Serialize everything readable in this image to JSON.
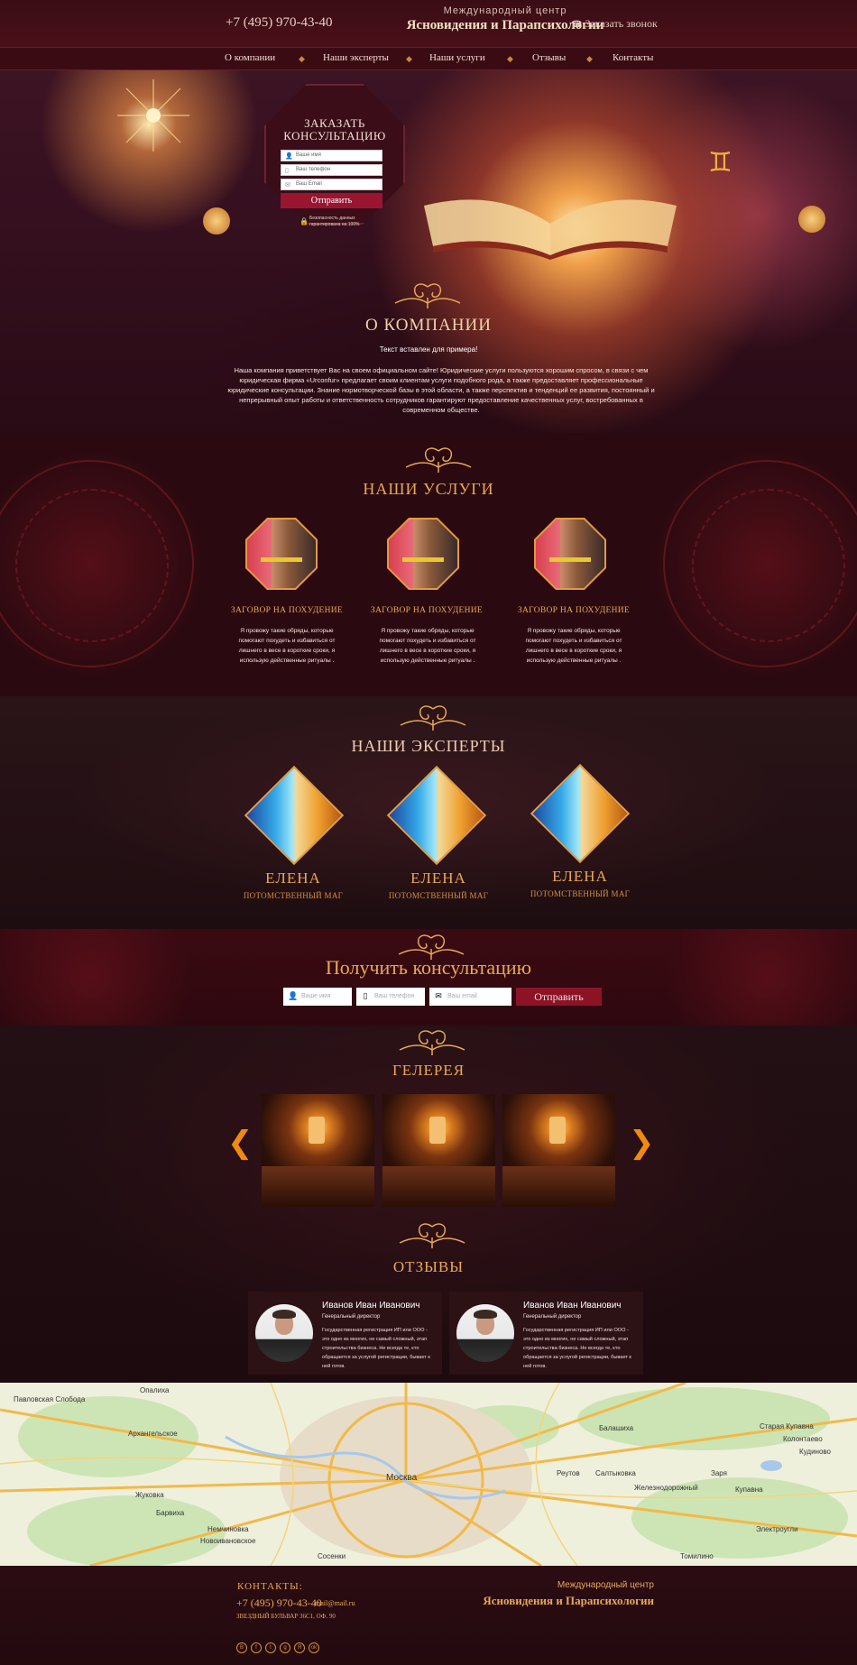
{
  "header": {
    "phone": "+7 (495) 970-43-40",
    "brand_subtitle": "Международный центр",
    "brand_title": "Ясновидения и Парапсихологии",
    "callback_label": "Заказать звонок"
  },
  "nav": {
    "items": [
      {
        "label": "О компании"
      },
      {
        "label": "Наши эксперты"
      },
      {
        "label": "Наши услуги"
      },
      {
        "label": "Отзывы"
      },
      {
        "label": "Контакты"
      }
    ]
  },
  "hero_form": {
    "title_line1": "ЗАКАЗАТЬ",
    "title_line2": "КОНСУЛЬТАЦИЮ",
    "name_placeholder": "Ваше имя",
    "phone_placeholder": "Ваш телефон",
    "email_placeholder": "Ваш Email",
    "submit_label": "Отправить",
    "security_note": "Безопасность данных гарантирована на 100%"
  },
  "about": {
    "title": "О КОМПАНИИ",
    "subtitle": "Текст вставлен для примера!",
    "text": "Наша компания приветствует Вас на своем официальном сайте! Юридические услуги пользуются  хорошим спросом, в связи с чем юридическая фирма «Urconfur» предлагает своим клиентам услуги подобного рода, а также предоставляет профессиональные юридические консультации. Знание нормотворческой базы в этой области, а также перспектив и тенденций ее развития, постоянный и непрерывный опыт работы и ответственность сотрудников гарантируют предоставление качественных услуг, востребованных в современном обществе."
  },
  "services": {
    "title": "НАШИ УСЛУГИ",
    "items": [
      {
        "title": "ЗАГОВОР НА ПОХУДЕНИЕ",
        "text": "Я провожу такие обряды, которые помогают похудеть и избавиться от лишнего в весе в короткие сроки, я использую действенные ритуалы ."
      },
      {
        "title": "ЗАГОВОР НА ПОХУДЕНИЕ",
        "text": "Я провожу такие обряды, которые помогают похудеть и избавиться от лишнего в весе в короткие сроки, я использую действенные ритуалы ."
      },
      {
        "title": "ЗАГОВОР НА ПОХУДЕНИЕ",
        "text": "Я провожу такие обряды, которые помогают похудеть и избавиться от лишнего в весе в короткие сроки, я использую действенные ритуалы ."
      }
    ]
  },
  "experts": {
    "title": "НАШИ ЭКСПЕРТЫ",
    "items": [
      {
        "name": "ЕЛЕНА",
        "role": "ПОТОМСТВЕННЫЙ МАГ"
      },
      {
        "name": "ЕЛЕНА",
        "role": "ПОТОМСТВЕННЫЙ МАГ"
      },
      {
        "name": "ЕЛЕНА",
        "role": "ПОТОМСТВЕННЫЙ МАГ"
      }
    ]
  },
  "consult": {
    "title": "Получить консультацию",
    "name_placeholder": "Ваше имя",
    "phone_placeholder": "Ваш телефон",
    "email_placeholder": "Ваш email",
    "submit_label": "Отправить"
  },
  "gallery": {
    "title": "ГЕЛЕРЕЯ",
    "prev_icon": "chevron-left-icon",
    "next_icon": "chevron-right-icon"
  },
  "reviews": {
    "title": "ОТЗЫВЫ",
    "items": [
      {
        "name": "Иванов Иван Иванович",
        "role": "Генеральный директор",
        "text": "Государственная регистрация ИП или ООО - это одно из многих, не самый сложный, этап строительства бизнеса. Не всегда те, кто обращается за услугой регистрации, бывает к ней готов."
      },
      {
        "name": "Иванов Иван Иванович",
        "role": "Генеральный директор",
        "text": "Государственная регистрация ИП или ООО - это одно из многих, не самый сложный, этап строительства бизнеса. Не всегда те, кто обращается за услугой регистрации, бывает к ней готов."
      }
    ]
  },
  "map": {
    "labels": [
      "Павловская Слобода",
      "Опалиха",
      "Балашиха",
      "Старая Купавна",
      "Архангельское",
      "Реутов",
      "Салтыковка",
      "Москва",
      "Железнодорожный",
      "Купавна",
      "Электроугли",
      "Барвиха",
      "Немчиновка",
      "Новоивановское",
      "Жуковка",
      "Заря",
      "Кудиново",
      "Колонтаево",
      "Сосенки",
      "Томилино"
    ]
  },
  "footer": {
    "contacts_title": "КОНТАКТЫ:",
    "phone": "+7 (495) 970-43-40",
    "email": "mail@mail.ru",
    "address": "ЗВЕЗДНЫЙ БУЛЬВАР 36С1, ОФ. 90",
    "brand_subtitle": "Международный центр",
    "brand_title": "Ясновидения и Парапсихологии",
    "social": [
      "В",
      "f",
      "t",
      "g",
      "Я",
      "ok"
    ]
  },
  "colors": {
    "accent_orange": "#e8a857",
    "burgundy": "#8c1326",
    "background": "#1f0a0e"
  }
}
